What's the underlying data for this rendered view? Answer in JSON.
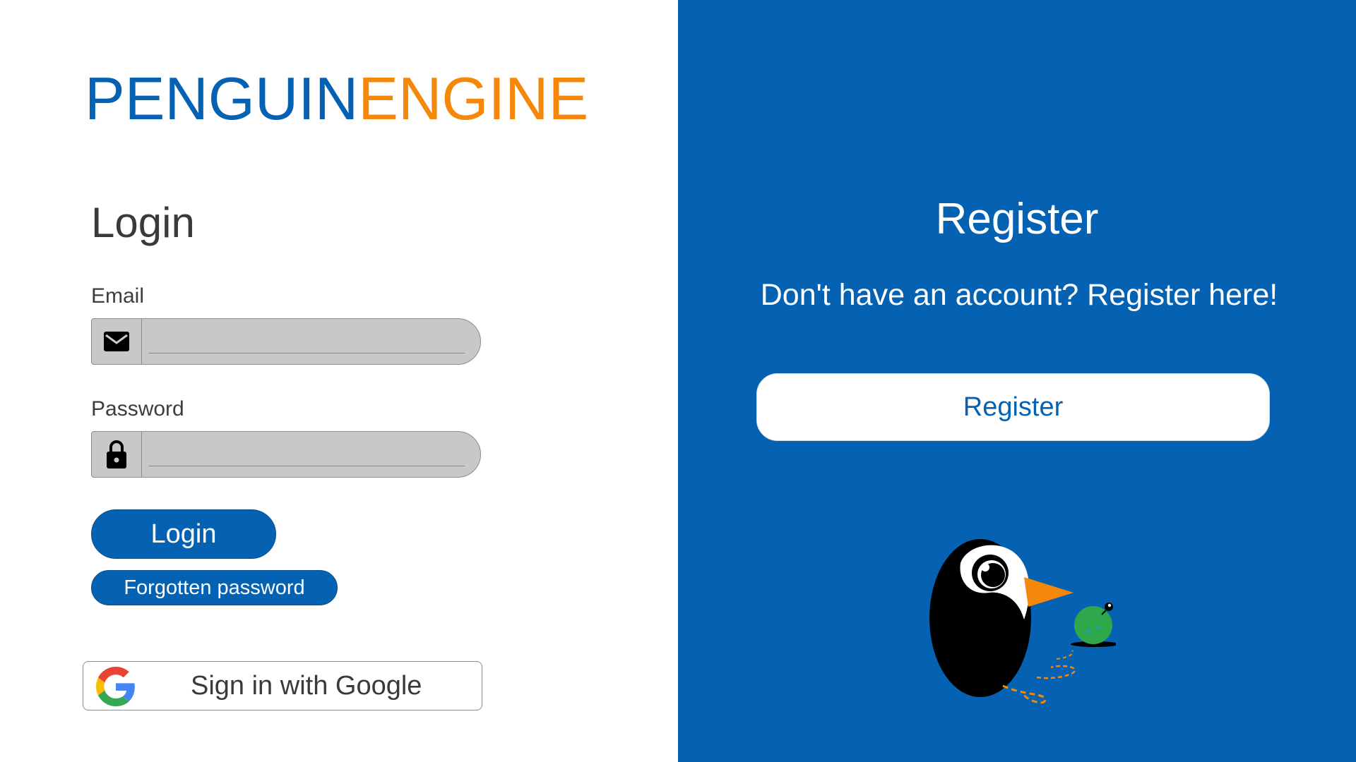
{
  "colors": {
    "brand_blue": "#0562b3",
    "brand_orange": "#f5870a",
    "field_gray": "#c8c8c8"
  },
  "logo": {
    "part_1": "PENGUIN",
    "part_2": "ENGINE"
  },
  "login": {
    "title": "Login",
    "email": {
      "label": "Email",
      "value": "",
      "placeholder": "",
      "icon": "envelope-icon"
    },
    "password": {
      "label": "Password",
      "value": "",
      "placeholder": "",
      "icon": "lock-icon"
    },
    "login_button": "Login",
    "forgot_button": "Forgotten password",
    "google_button": {
      "label": "Sign in with Google",
      "icon": "google-icon"
    }
  },
  "register": {
    "title": "Register",
    "subtitle": "Don't have an account? Register here!",
    "button": "Register",
    "illustration": "penguin-illustration"
  }
}
